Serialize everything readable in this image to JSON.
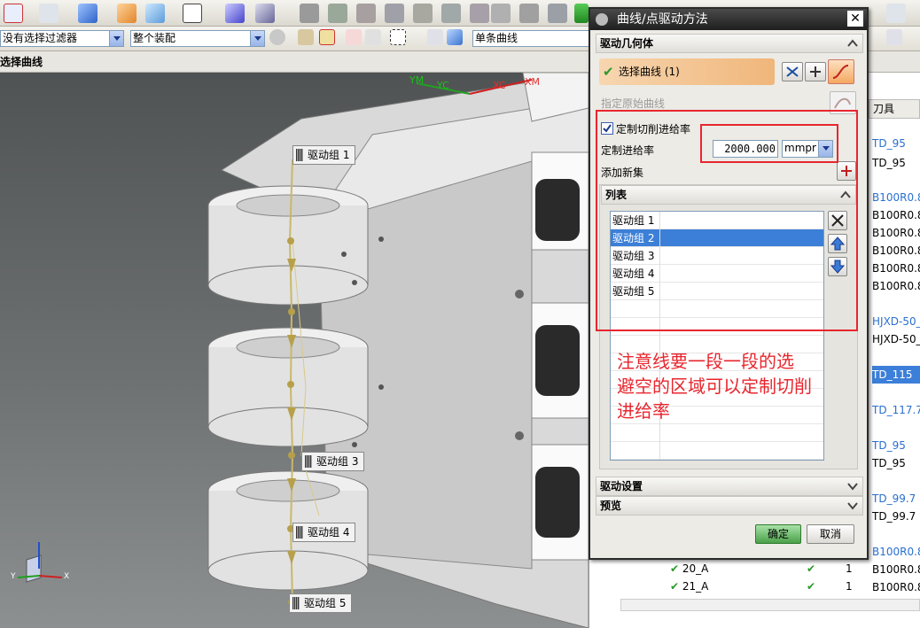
{
  "toolbar2": {
    "filter_select": "没有选择过滤器",
    "scope_select": "整个装配",
    "curve_rule_select": "单条曲线"
  },
  "selection_bar": {
    "title": "选择曲线"
  },
  "viewport": {
    "axes": {
      "ym": "YM",
      "yc": "YC",
      "xc": "XC",
      "xm": "XM"
    },
    "triad": {
      "y": "Y",
      "x": "X"
    },
    "drive_labels": [
      "驱动组 1",
      "驱动组 3",
      "驱动组 4",
      "驱动组 5"
    ]
  },
  "dialog": {
    "title": "曲线/点驱动方法",
    "drive_geometry": {
      "header": "驱动几何体",
      "select_curve": "选择曲线 (1)",
      "specify_original_curve": "指定原始曲线"
    },
    "custom_feed": {
      "checkbox_label": "定制切削进给率",
      "checked": true,
      "rate_label": "定制进给率",
      "rate_value": "2000.000",
      "unit": "mmpr",
      "add_new_set": "添加新集"
    },
    "list": {
      "header": "列表",
      "items": [
        "驱动组 1",
        "驱动组 2",
        "驱动组 3",
        "驱动组 4",
        "驱动组 5"
      ],
      "selected_index": 1
    },
    "drive_settings": "驱动设置",
    "preview": "预览",
    "ok": "确定",
    "cancel": "取消"
  },
  "annotation": {
    "lines": [
      "注意线要一段一段的选",
      "避空的区域可以定制切削",
      "进给率"
    ],
    "color": "#e8262e"
  },
  "nav_panel": {
    "column_header": "刀具",
    "cells": [
      {
        "text": "TD_95",
        "blue": true
      },
      {
        "text": "TD_95",
        "blue": false
      },
      {
        "text": "B100R0.8",
        "blue": true
      },
      {
        "text": "B100R0.8",
        "blue": false
      },
      {
        "text": "B100R0.8",
        "blue": false
      },
      {
        "text": "B100R0.8",
        "blue": false
      },
      {
        "text": "B100R0.8",
        "blue": false
      },
      {
        "text": "B100R0.8",
        "blue": false
      },
      {
        "text": "HJXD-50_",
        "blue": true
      },
      {
        "text": "HJXD-50_",
        "blue": false
      },
      {
        "text": "TD_115",
        "blue": false,
        "selected": true
      },
      {
        "text": "TD_117.7",
        "blue": true
      },
      {
        "text": "TD_95",
        "blue": true
      },
      {
        "text": "TD_95",
        "blue": false
      },
      {
        "text": "TD_99.7",
        "blue": true
      },
      {
        "text": "TD_99.7",
        "blue": false
      },
      {
        "text": "B100R0.8",
        "blue": true
      },
      {
        "text": "B100R0.8",
        "blue": false
      },
      {
        "text": "B100R0.8",
        "blue": false
      }
    ],
    "ops": [
      {
        "name": "20_A",
        "count": "1"
      },
      {
        "name": "21_A",
        "count": "1"
      }
    ]
  }
}
